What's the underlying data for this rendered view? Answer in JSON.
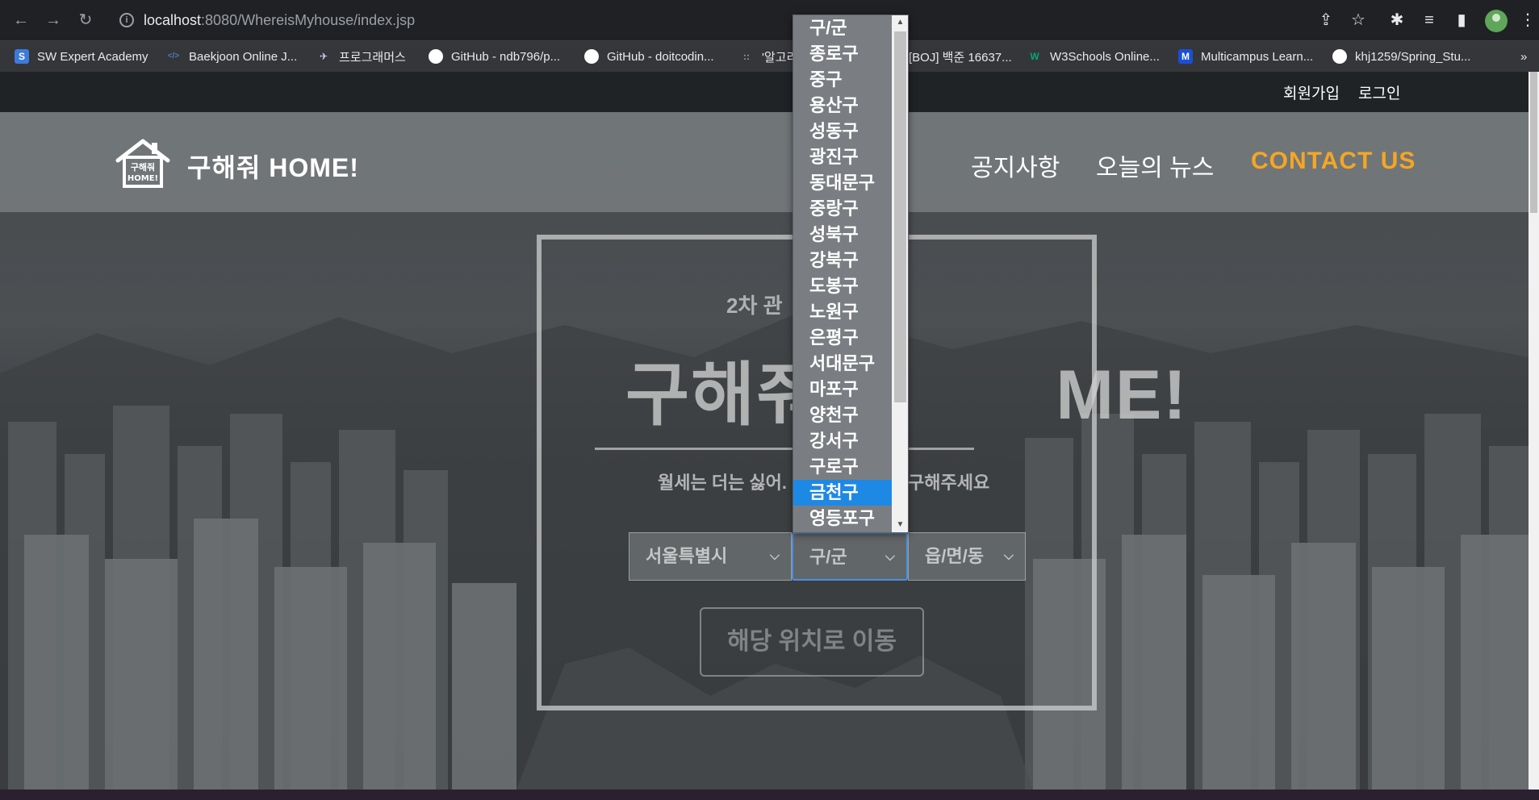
{
  "browser": {
    "url_host": "localhost",
    "url_path": ":8080/WhereisMyhouse/index.jsp",
    "bookmarks": [
      {
        "label": "SW Expert Academy",
        "icon": "S"
      },
      {
        "label": "Baekjoon Online J...",
        "icon": "</>"
      },
      {
        "label": "프로그래머스",
        "icon": "✈"
      },
      {
        "label": "GitHub - ndb796/p...",
        "icon": "github"
      },
      {
        "label": "GitHub - doitcodin...",
        "icon": "github"
      },
      {
        "label": "'알고리",
        "icon": "::"
      },
      {
        "label": "[BOJ] 백준 16637...",
        "icon": ""
      },
      {
        "label": "W3Schools Online...",
        "icon": "W"
      },
      {
        "label": "Multicampus Learn...",
        "icon": "M"
      },
      {
        "label": "khj1259/Spring_Stu...",
        "icon": "github"
      }
    ],
    "more": "»"
  },
  "topbar": {
    "signup": "회원가입",
    "login": "로그인"
  },
  "header": {
    "logo_text_1": "구해줘",
    "logo_text_2": "HOME!",
    "brand": "구해줘 HOME!",
    "menu": {
      "notice": "공지사항",
      "news": "오늘의 뉴스",
      "contact": "CONTACT US"
    }
  },
  "hero": {
    "subtitle": "2차 관",
    "title_left": "구해줘",
    "title_right": "ME!",
    "desc_left": "월세는 더는 싫어.",
    "desc_right": "구해주세요"
  },
  "search": {
    "city": "서울특별시",
    "gu": "구/군",
    "dong": "읍/면/동",
    "button": "해당 위치로 이동"
  },
  "dropdown": {
    "options": [
      "구/군",
      "종로구",
      "중구",
      "용산구",
      "성동구",
      "광진구",
      "동대문구",
      "중랑구",
      "성북구",
      "강북구",
      "도봉구",
      "노원구",
      "은평구",
      "서대문구",
      "마포구",
      "양천구",
      "강서구",
      "구로구",
      "금천구",
      "영등포구"
    ],
    "selected": "금천구"
  },
  "colors": {
    "accent": "#f5a623",
    "selection": "#1e88e5",
    "focus": "#4a90e2"
  }
}
